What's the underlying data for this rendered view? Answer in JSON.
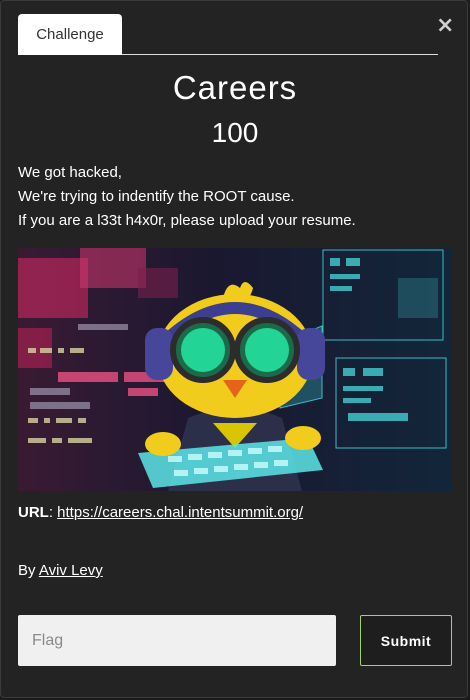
{
  "modal": {
    "close_label": "×",
    "tab_label": "Challenge"
  },
  "challenge": {
    "name": "Careers",
    "value": "100",
    "description": [
      "We got hacked,",
      "We're trying to indentify the ROOT cause.",
      "If you are a l33t h4x0r, please upload your resume."
    ],
    "url_label": "URL",
    "url": "https://careers.chal.intentsummit.org/",
    "author_prefix": "By",
    "author": "Aviv Levy"
  },
  "form": {
    "flag_placeholder": "Flag",
    "flag_value": "",
    "submit_label": "Submit"
  },
  "colors": {
    "background": "#232323",
    "submit_border": "#9fd36f"
  }
}
